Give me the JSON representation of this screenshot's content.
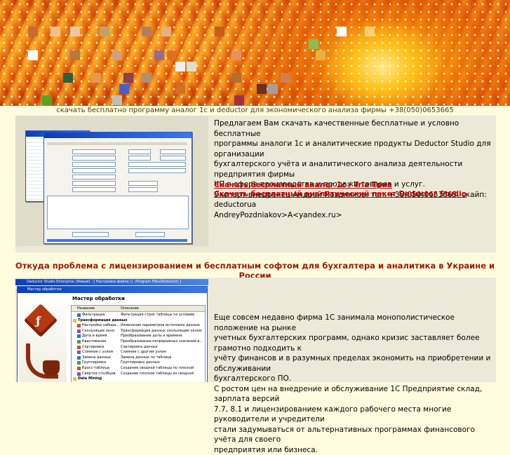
{
  "caption": "скачать бесплатно программу аналог 1с и deductor для экономического анализа фирмы +38(050)0653665",
  "section1": {
    "intro_lines": [
      "Предлагаем Вам скачать качественные бесплатные и условно бесплатные",
      "программы аналоги 1с и аналитические продукты Deductor Studio для организации",
      "бухгалтерского учёта и аналитического анализа деятельности предприятия фирмы",
      "ЧП в сфере производства и продажи товаров и услуг.",
      "Эксперт внедренец Андрей Поздняков, тел. +38(050)0653665, скайп: deductorua",
      "AndreyPozdniakov>A<yandex.ru>"
    ],
    "links": [
      "Скачать бесплатный аналог 1с / Tria Триа",
      "Скачать бесплатный аналитический пакет Deductor Studio"
    ]
  },
  "heading": "Откуда проблема с лицензированием и бесплатным софтом для бухгалтера и аналитика в Украине и России",
  "section2": {
    "window_title": "Deductor Studio Enterprise (Новый) - [ Настройки файла (), (Program Files/Deductor) ]",
    "wizard_title": "Мастер обработки",
    "wizard_header": "Мастер обработки",
    "col_name": "Название",
    "col_desc": "Описание",
    "wizard_rows": [
      [
        "Фильтрация",
        "Фильтрация строк таблицы по условию"
      ],
      [
        "Трансформация данных",
        ""
      ],
      [
        "Настройка набора...",
        "Изменение параметров источника данных"
      ],
      [
        "Скользящее окно",
        "Трансформация данных скользящим окном"
      ],
      [
        "Дата и время",
        "Преобразование даты и времени"
      ],
      [
        "Квантование",
        "Преобразование непрерывных значений в..."
      ],
      [
        "Сортировка",
        "Сортировка данных"
      ],
      [
        "Слияние с узлом",
        "Слияние с другим узлом"
      ],
      [
        "Замена данных",
        "Замена данных по таблице"
      ],
      [
        "Группировка",
        "Группировка данных"
      ],
      [
        "Кросс-таблица",
        "Создание сводной таблицы по плоской"
      ],
      [
        "Свёртка столбцов",
        "Создание плоской таблицы из сводной"
      ],
      [
        "Data Mining",
        ""
      ]
    ],
    "body_lines": [
      "Еще совсем недавно фирма 1С занимала монополистическое положение на рынке",
      "учетных бухгалтерских программ, однако кризис заставляет более грамотно подходить к",
      "учёту финансов и в разумных пределах экономить на приобретении и обслуживании",
      "бухгалтерского ПО.",
      "С ростом цен на внедрение и обслуживание 1С Предприятие склад, зарплата версий",
      "7.7, 8.1 и лицензированием каждого рабочего места многие руководители и учредители",
      "стали задумываться от альтернативных программах финансового учёта для своего",
      "предприятия или бизнеса."
    ]
  },
  "colors": {
    "page_bg": "#fffbdf",
    "panel_bg": "#ece9d8",
    "link": "#c00000",
    "heading": "#9a1a00",
    "caption": "#4d3f00"
  }
}
